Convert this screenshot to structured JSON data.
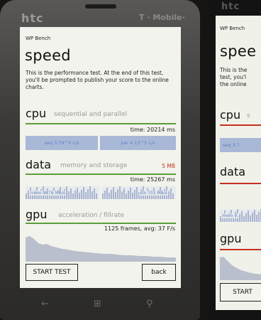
{
  "phone1": {
    "brand": "htc",
    "carrier": "T · Mobile·",
    "app_name": "WP Bench",
    "page_title": "speed",
    "description": "This is the performance test. At the end of this test, you'll be prompted to publish your score to the online charts.",
    "cpu": {
      "title": "cpu",
      "subtitle": "sequential and parallel",
      "time": "time: 20214 ms",
      "seq": "seq 3.79^5 L/s",
      "par": "par 4.13^5 L/s"
    },
    "data": {
      "title": "data",
      "subtitle": "memory and storage",
      "size": "5 MB",
      "time": "time: 25267 ms",
      "mem": "mem 9876 MB/s",
      "sto": "sto 703 MB/s"
    },
    "gpu": {
      "title": "gpu",
      "subtitle": "acceleration / fillrate",
      "frames": "1125 frames, avg: 37 F/s"
    },
    "start_button": "START TEST",
    "back_button": "back"
  },
  "phone2": {
    "brand": "htc",
    "app_name": "WP Bench",
    "page_title": "spee",
    "desc_lines": [
      "This is the",
      "test, you'l",
      "the online"
    ],
    "cpu_title": "cpu",
    "cpu_sub": "s",
    "cpu_bar": "seq 3.7",
    "data_title": "data",
    "data_bar": "mem 9.",
    "gpu_title": "gpu",
    "start_button": "START"
  },
  "colors": {
    "screen_bg": "#f2f3ec",
    "accent_green": "#5a9e3a",
    "accent_red": "#c8301f",
    "bar_fill": "#a9b8d6",
    "bar_text": "#5d7fc8"
  }
}
